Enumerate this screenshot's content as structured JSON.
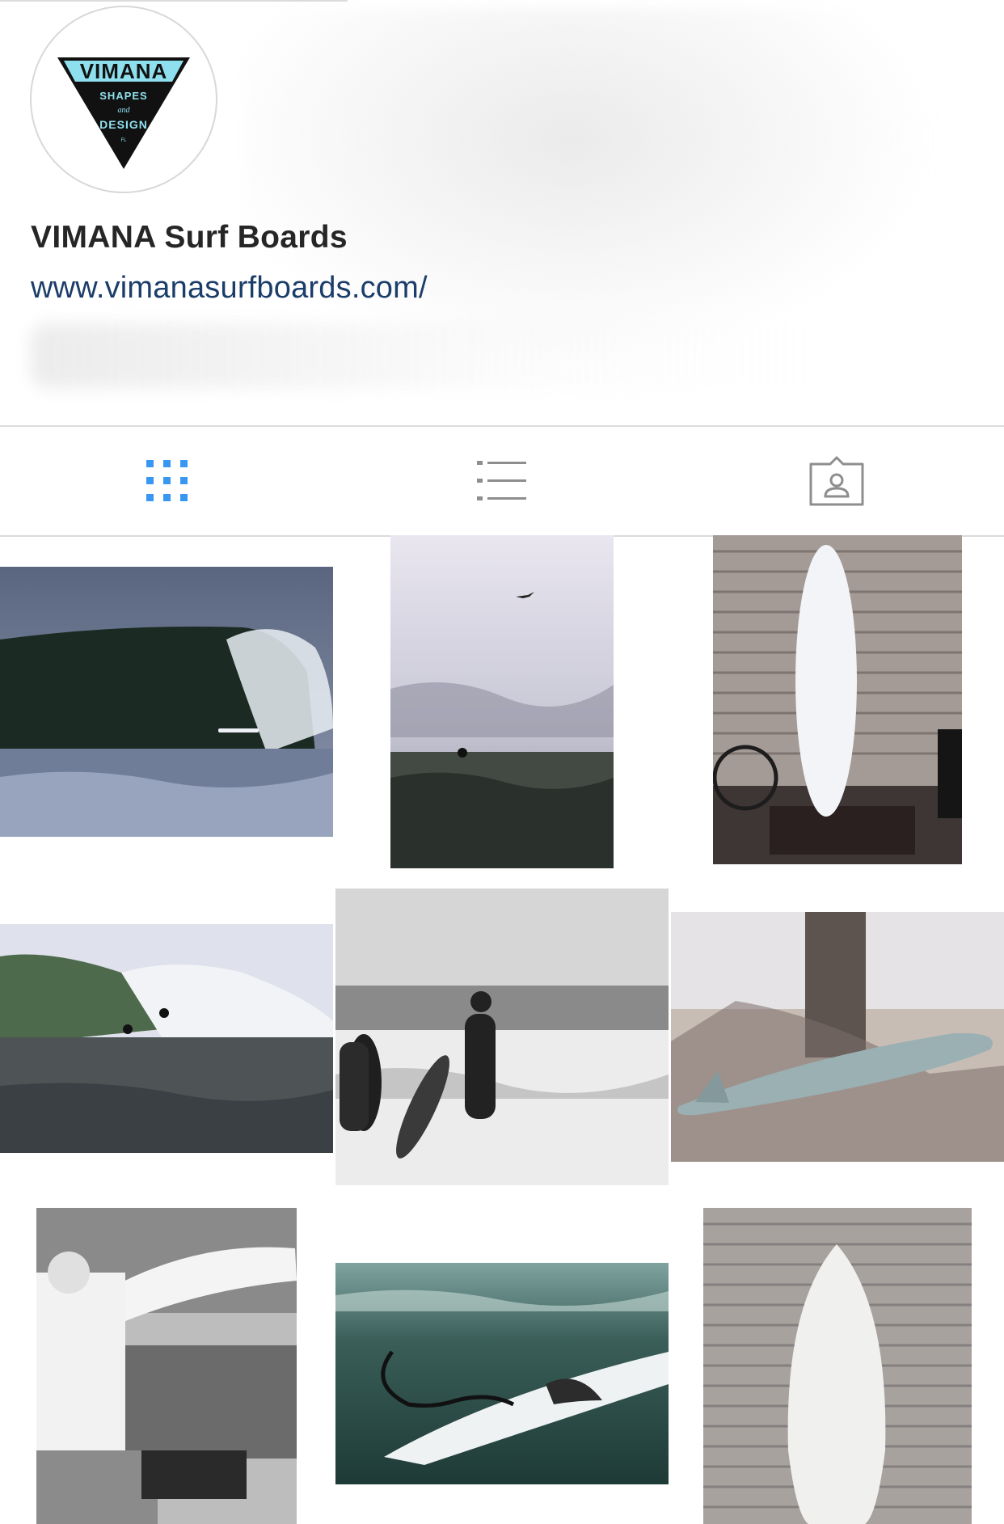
{
  "profile": {
    "name": "VIMANA Surf Boards",
    "website": "www.vimanasurfboards.com/",
    "logo": {
      "brand": "VIMANA",
      "line1": "SHAPES",
      "line2": "and",
      "line3": "DESIGN",
      "line4": "FL",
      "accent_color": "#8fe0ee"
    }
  },
  "tabs": [
    {
      "id": "grid",
      "icon": "grid-icon",
      "active": true,
      "color": "#3897f0"
    },
    {
      "id": "list",
      "icon": "list-icon",
      "active": false,
      "color": "#8e8e8e"
    },
    {
      "id": "tagged",
      "icon": "tagged-person-icon",
      "active": false,
      "color": "#8e8e8e"
    }
  ],
  "grid_posts": [
    {
      "subject": "barreling wave with surfer"
    },
    {
      "subject": "surfer in ocean under overcast sky with bird"
    },
    {
      "subject": "white surfboard against garage shutter"
    },
    {
      "subject": "surfer riding green wave"
    },
    {
      "subject": "two surfers walking into surf black and white"
    },
    {
      "subject": "surfboard lying on sand by tree"
    },
    {
      "subject": "shaper with surfboard in van"
    },
    {
      "subject": "underwater view of surfboard fin and leash"
    },
    {
      "subject": "fish surfboard against garage shutter"
    }
  ]
}
